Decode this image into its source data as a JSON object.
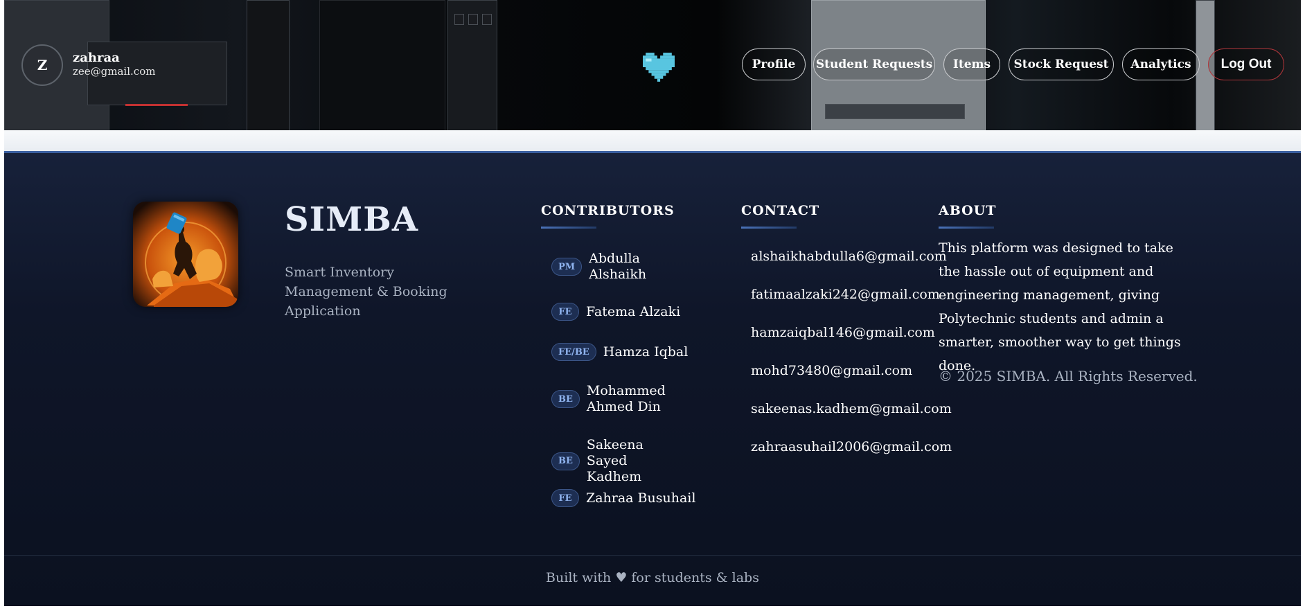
{
  "header": {
    "user": {
      "initial": "Z",
      "name": "zahraa",
      "email": "zee@gmail.com"
    },
    "logo_icon": "pixel-heart-icon",
    "nav": [
      {
        "label": "Profile"
      },
      {
        "label": "Student Requests"
      },
      {
        "label": "Items"
      },
      {
        "label": "Stock Request"
      },
      {
        "label": "Analytics"
      }
    ],
    "logout_label": "Log Out"
  },
  "footer": {
    "brand": {
      "name": "SIMBA",
      "tagline": "Smart Inventory Management & Booking Application",
      "logo_icon": "lion-king-logo-icon"
    },
    "contributors": {
      "title": "CONTRIBUTORS",
      "items": [
        {
          "role": "PM",
          "name": "Abdulla Alshaikh"
        },
        {
          "role": "FE",
          "name": "Fatema Alzaki"
        },
        {
          "role": "FE/BE",
          "name": "Hamza Iqbal"
        },
        {
          "role": "BE",
          "name": "Mohammed Ahmed Din"
        },
        {
          "role": "BE",
          "name": "Sakeena Sayed Kadhem"
        },
        {
          "role": "FE",
          "name": "Zahraa Busuhail"
        }
      ]
    },
    "contact": {
      "title": "CONTACT",
      "emails": [
        "alshaikhabdulla6@gmail.com",
        "fatimaalzaki242@gmail.com",
        "hamzaiqbal146@gmail.com",
        "mohd73480@gmail.com",
        "sakeenas.kadhem@gmail.com",
        "zahraasuhail2006@gmail.com"
      ]
    },
    "about": {
      "title": "ABOUT",
      "text": "This platform was designed to take the hassle out of equipment and engineering management, giving Polytechnic students and admin a smarter, smoother way to get things done.",
      "copyright": "© 2025 SIMBA. All Rights Reserved."
    },
    "built_with": "Built with ♥ for students & labs"
  },
  "colors": {
    "accent_blue": "#3a5fa0",
    "badge_text": "#8fb3ee",
    "logout_border": "#b0363b",
    "logo_orange": "#e8740f"
  }
}
